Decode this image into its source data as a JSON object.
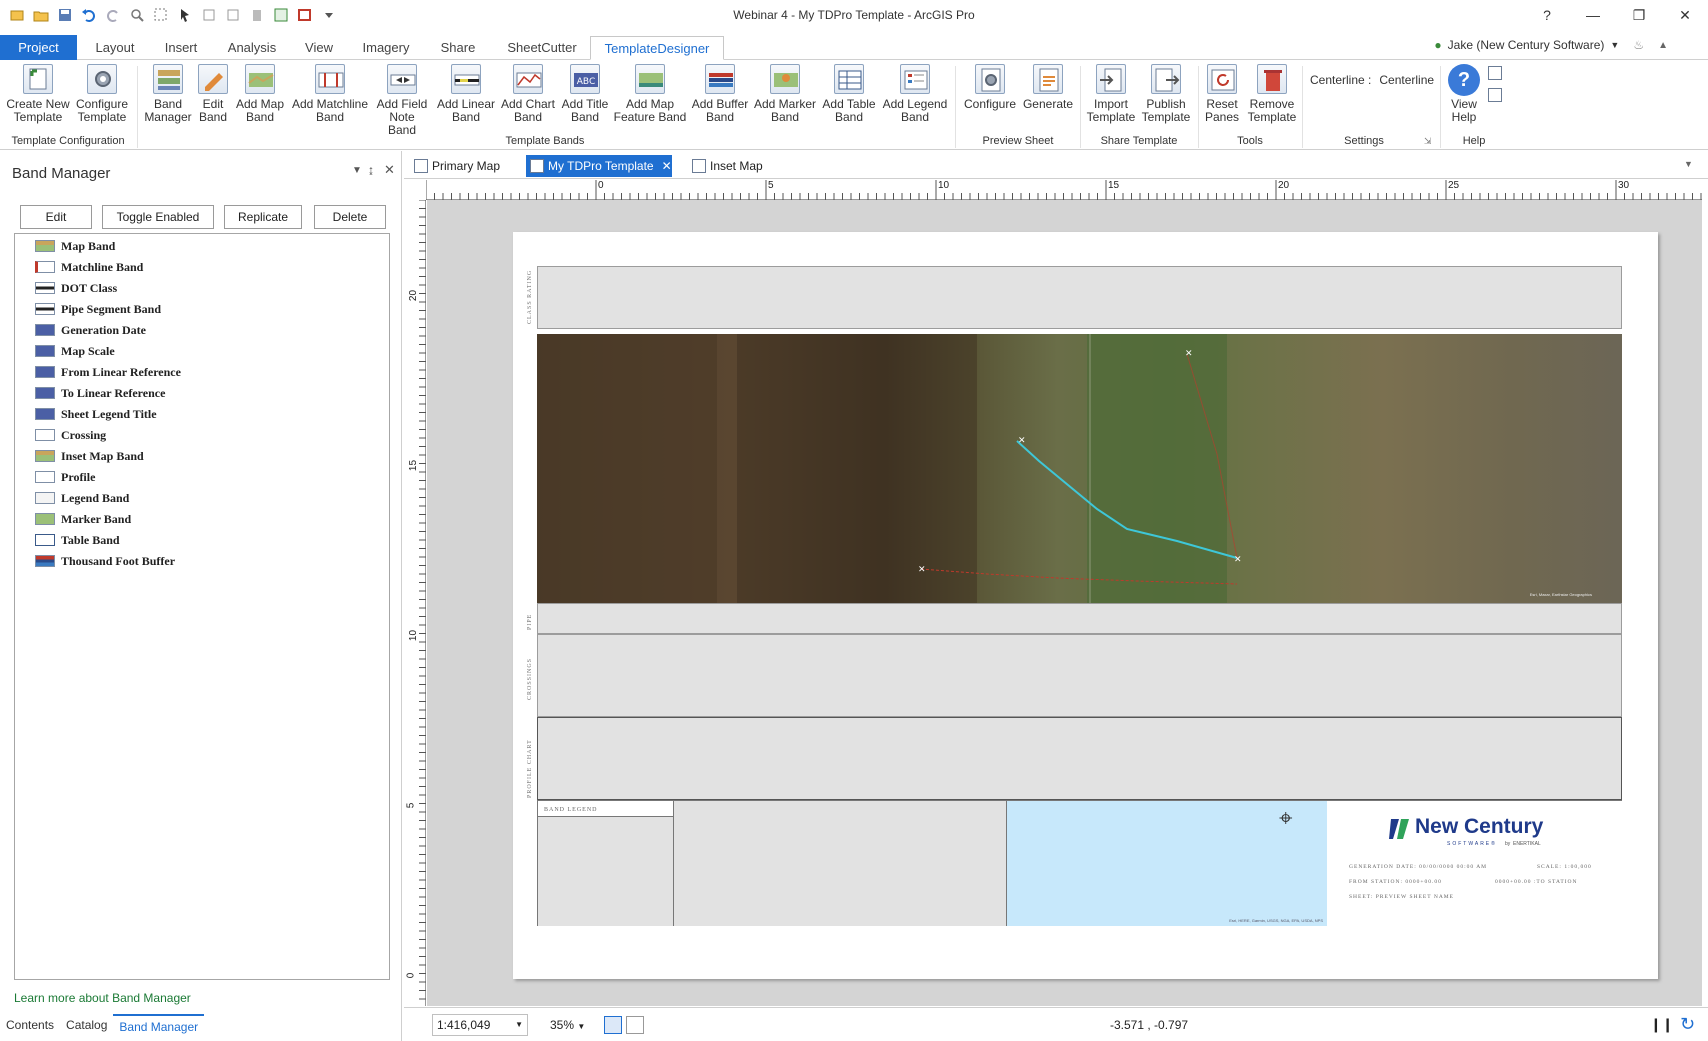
{
  "window": {
    "title": "Webinar 4 - My TDPro Template - ArcGIS Pro",
    "help": "?"
  },
  "ribbon_tabs": [
    "Project",
    "Layout",
    "Insert",
    "Analysis",
    "View",
    "Imagery",
    "Share",
    "SheetCutter",
    "TemplateDesigner"
  ],
  "user": {
    "name": "Jake (New Century Software)"
  },
  "ribbon": {
    "buttons": [
      {
        "l1": "Create New",
        "l2": "Template"
      },
      {
        "l1": "Configure",
        "l2": "Template"
      },
      {
        "l1": "Band",
        "l2": "Manager"
      },
      {
        "l1": "Edit",
        "l2": "Band"
      },
      {
        "l1": "Add Map",
        "l2": "Band"
      },
      {
        "l1": "Add Matchline",
        "l2": "Band"
      },
      {
        "l1": "Add Field",
        "l2": "Note Band"
      },
      {
        "l1": "Add Linear",
        "l2": "Band"
      },
      {
        "l1": "Add Chart",
        "l2": "Band"
      },
      {
        "l1": "Add Title",
        "l2": "Band"
      },
      {
        "l1": "Add Map",
        "l2": "Feature Band"
      },
      {
        "l1": "Add Buffer",
        "l2": "Band"
      },
      {
        "l1": "Add Marker",
        "l2": "Band"
      },
      {
        "l1": "Add Table",
        "l2": "Band"
      },
      {
        "l1": "Add Legend",
        "l2": "Band"
      },
      {
        "l1": "Configure",
        "l2": ""
      },
      {
        "l1": "Generate",
        "l2": ""
      },
      {
        "l1": "Import",
        "l2": "Template"
      },
      {
        "l1": "Publish",
        "l2": "Template"
      },
      {
        "l1": "Reset",
        "l2": "Panes"
      },
      {
        "l1": "Remove",
        "l2": "Template"
      },
      {
        "l1": "View",
        "l2": "Help"
      }
    ],
    "groups": [
      "Template Configuration",
      "Template Bands",
      "Preview Sheet",
      "Share Template",
      "Tools",
      "Settings",
      "Help"
    ],
    "settings": {
      "label": "Centerline :",
      "value": "Centerline"
    }
  },
  "band_manager": {
    "title": "Band Manager",
    "buttons": [
      "Edit",
      "Toggle Enabled",
      "Replicate",
      "Delete"
    ],
    "bands": [
      "Map Band",
      "Matchline Band",
      "DOT Class",
      "Pipe Segment Band",
      "Generation Date",
      "Map Scale",
      "From Linear Reference",
      "To Linear Reference",
      "Sheet Legend Title",
      "Crossing",
      "Inset Map Band",
      "Profile",
      "Legend Band",
      "Marker Band",
      "Table Band",
      "Thousand Foot Buffer"
    ],
    "link": "Learn more about Band Manager",
    "bottom_tabs": [
      "Contents",
      "Catalog",
      "Band Manager"
    ]
  },
  "doc_tabs": [
    "Primary Map",
    "My TDPro Template",
    "Inset Map"
  ],
  "ruler": {
    "h_labels": [
      "0",
      "5",
      "10",
      "15",
      "20",
      "25",
      "30"
    ],
    "v_labels": [
      "20",
      "15",
      "10",
      "5",
      "0"
    ]
  },
  "layout": {
    "band_labels": {
      "class_rating": "CLASS RATING",
      "pipe": "PIPE",
      "crossings": "CROSSINGS",
      "profile_chart": "PROFILE CHART"
    },
    "band_legend": "BAND LEGEND",
    "logo": {
      "name": "New Century",
      "sub": "SOFTWARE®",
      "by": "by",
      "parent": "ENERTIKAL"
    },
    "info": {
      "gen_date": "GENERATION DATE: 00/00/0000 00:00 AM",
      "scale": "SCALE: 1:00,000",
      "from_station": "FROM STATION: 0000+00.00",
      "to_station": "0000+00.00 :TO STATION",
      "sheet": "SHEET: PREVIEW SHEET NAME"
    },
    "inset_credit": "Esri, HERE, Garmin, USGS, NGA, EPA, USDA, NPS",
    "map_credit": "Esri, Maxar, Earthstar Geographics"
  },
  "status": {
    "scale": "1:416,049",
    "zoom": "35%",
    "coords": "-3.571 , -0.797"
  },
  "colors": {
    "accent": "#1f6fd1",
    "route": "#3ec7d8",
    "inset_water": "#c7e8fb"
  }
}
